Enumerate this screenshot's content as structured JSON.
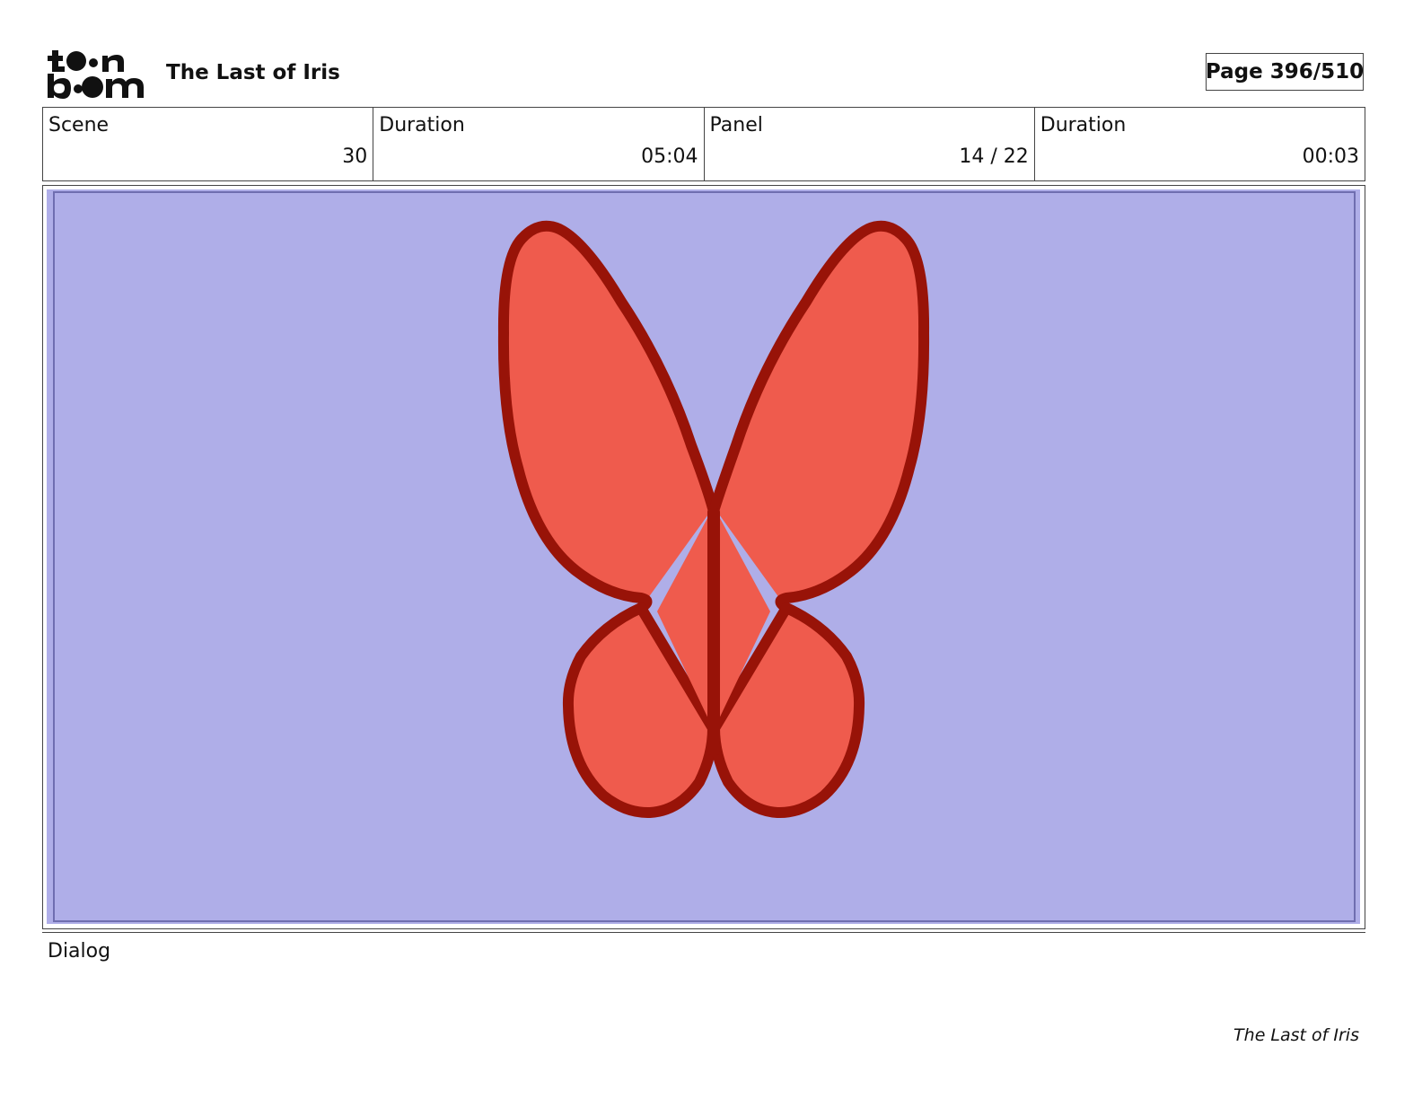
{
  "header": {
    "logo_text_line1": "toon",
    "logo_text_line2": "boom",
    "project_title": "The Last of Iris",
    "page_label": "Page 396/510"
  },
  "info": {
    "scene_label": "Scene",
    "scene_value": "30",
    "scene_duration_label": "Duration",
    "scene_duration_value": "05:04",
    "panel_label": "Panel",
    "panel_value": "14 / 22",
    "panel_duration_label": "Duration",
    "panel_duration_value": "00:03"
  },
  "panel": {
    "background_color": "#afaee8",
    "wing_fill_color": "#ef5b4d",
    "wing_outline_color": "#981308",
    "icon": "butterfly-drawing"
  },
  "dialog": {
    "label": "Dialog"
  },
  "footer": {
    "title": "The Last of Iris"
  }
}
